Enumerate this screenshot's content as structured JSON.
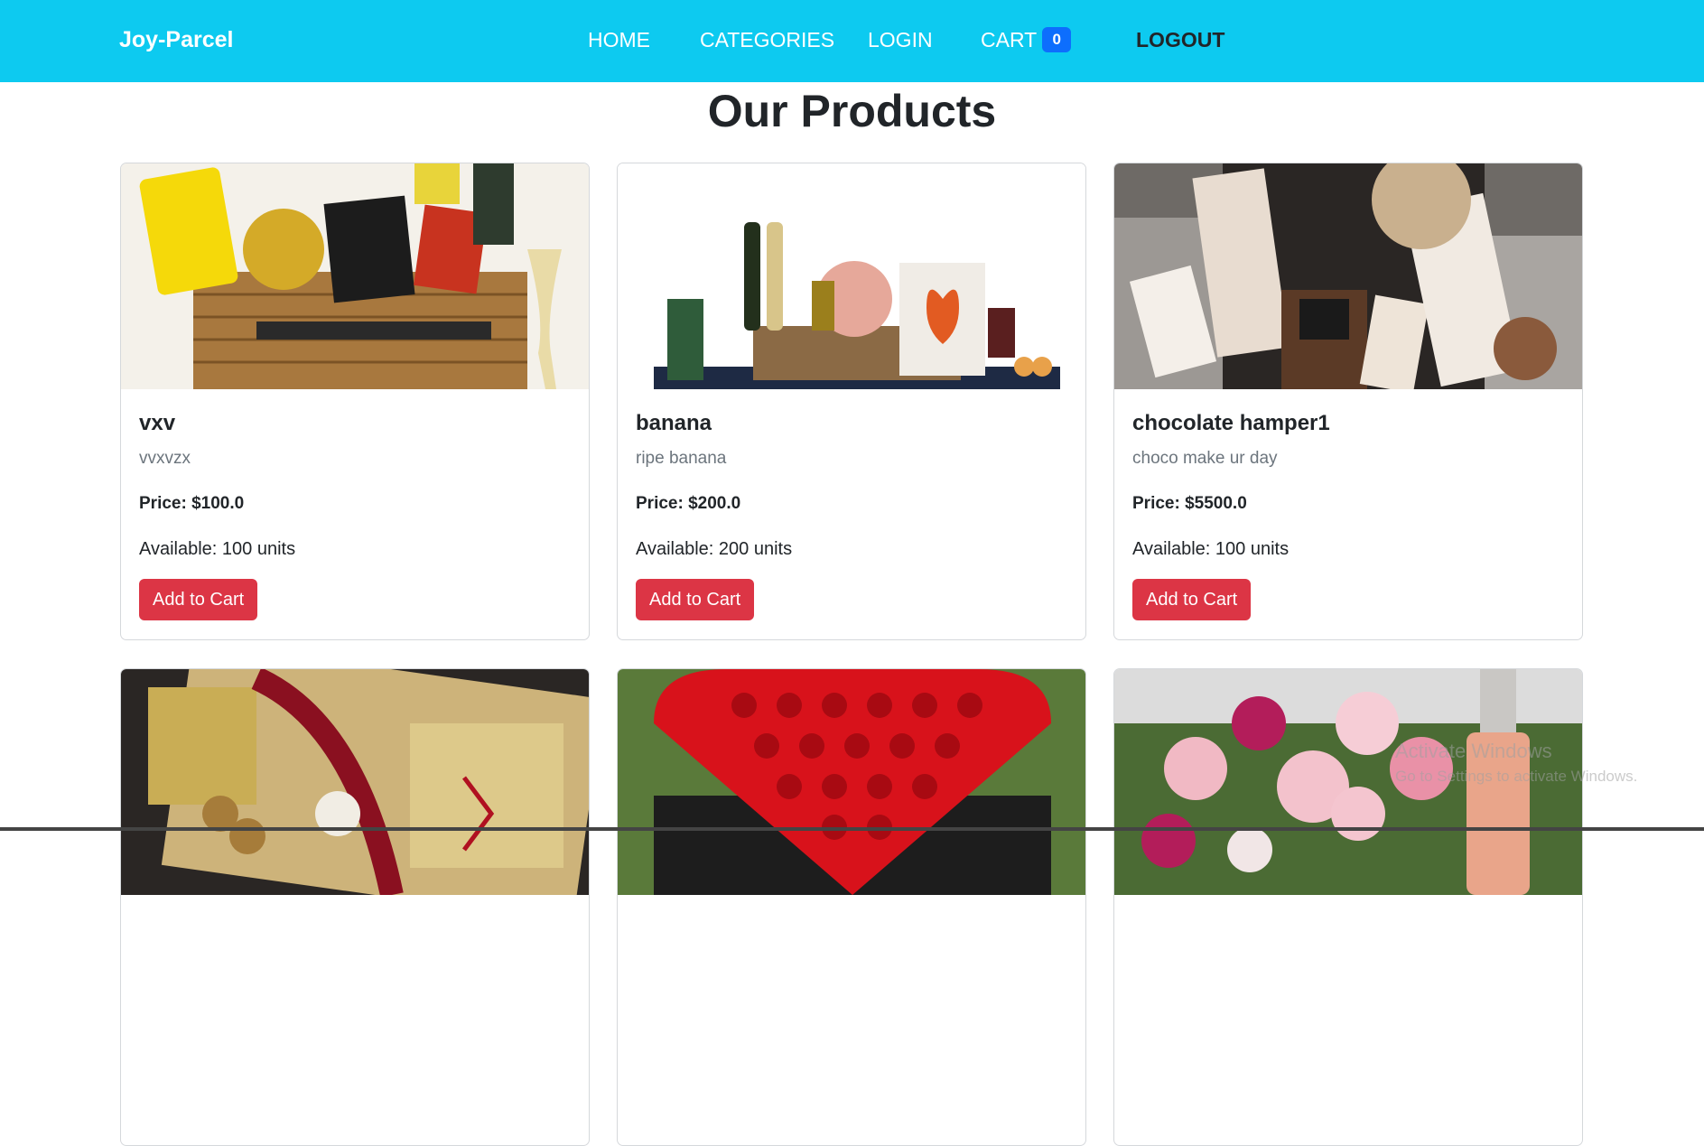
{
  "nav": {
    "brand": "Joy-Parcel",
    "home": "HOME",
    "categories": "CATEGORIES",
    "login": "LOGIN",
    "cart": "CART",
    "cart_count": "0",
    "logout": "LOGOUT"
  },
  "page_title": "Our Products",
  "products": [
    {
      "name": "vxv",
      "description": "vvxvzx",
      "price": "Price: $100.0",
      "available": "Available: 100 units",
      "button": "Add to Cart",
      "image": "gift-basket-image"
    },
    {
      "name": "banana",
      "description": "ripe banana",
      "price": "Price: $200.0",
      "available": "Available: 200 units",
      "button": "Add to Cart",
      "image": "gourmet-hamper-image"
    },
    {
      "name": "chocolate hamper1",
      "description": "choco make ur day",
      "price": "Price: $5500.0",
      "available": "Available: 100 units",
      "button": "Add to Cart",
      "image": "chocolate-hamper-image"
    },
    {
      "image": "christmas-hamper-image"
    },
    {
      "image": "rose-heart-box-image"
    },
    {
      "image": "pink-roses-bouquet-image"
    }
  ],
  "watermark": {
    "line1": "Activate Windows",
    "line2": "Go to Settings to activate Windows."
  },
  "colors": {
    "navbar": "#0dcaf0",
    "badge": "#0d6efd",
    "button": "#dc3545"
  }
}
